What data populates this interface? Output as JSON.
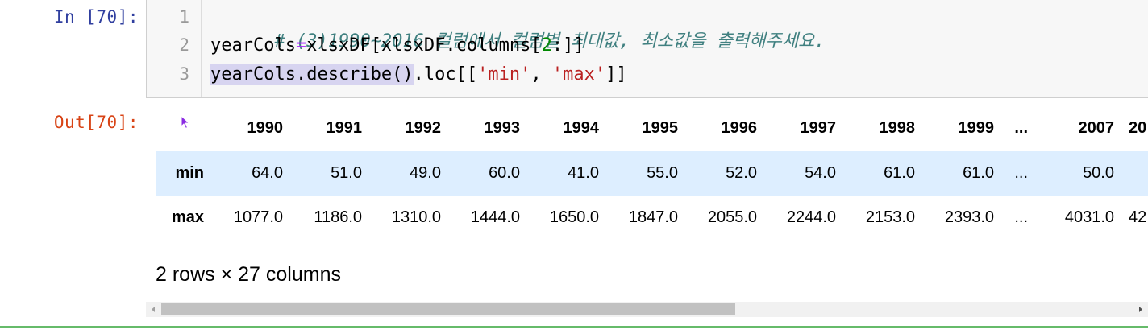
{
  "input_prompt": "In [70]:",
  "output_prompt": "Out[70]:",
  "code": {
    "line_numbers": [
      "1",
      "2",
      "3"
    ],
    "line1": {
      "comment": "# (3)1990~2016 컬럼에서 컬럼별 최대값, 최소값을 출력해주세요."
    },
    "line2": {
      "var": "yearCols",
      "op": "=",
      "expr_start": "xlsxDF[xlsxDF.columns[",
      "num": "2",
      "expr_end": ":]]"
    },
    "line3": {
      "highlighted": "yearCols.describe()",
      "mid": ".loc[[",
      "str1": "'min'",
      "sep": ", ",
      "str2": "'max'",
      "end": "]]"
    }
  },
  "table": {
    "columns": [
      "1990",
      "1991",
      "1992",
      "1993",
      "1994",
      "1995",
      "1996",
      "1997",
      "1998",
      "1999",
      "...",
      "2007",
      "20"
    ],
    "rows": [
      {
        "index": "min",
        "values": [
          "64.0",
          "51.0",
          "49.0",
          "60.0",
          "41.0",
          "55.0",
          "52.0",
          "54.0",
          "61.0",
          "61.0",
          "...",
          "50.0",
          ""
        ]
      },
      {
        "index": "max",
        "values": [
          "1077.0",
          "1186.0",
          "1310.0",
          "1444.0",
          "1650.0",
          "1847.0",
          "2055.0",
          "2244.0",
          "2153.0",
          "2393.0",
          "...",
          "4031.0",
          "42"
        ]
      }
    ]
  },
  "shape_note": "2 rows × 27 columns",
  "scrollbar": {
    "position_fraction": 0.58,
    "left_arrow": "◂",
    "right_arrow": "▸"
  },
  "colors": {
    "in_prompt": "#303f9f",
    "out_prompt": "#d84315",
    "comment": "#408080",
    "string": "#ba2121",
    "number": "#008800",
    "operator": "#aa22ff",
    "row_highlight": "#ddeeff",
    "cell_border": "#66bb6a"
  },
  "icons": [
    "mouse-pointer-icon",
    "scroll-left-arrow-icon",
    "scroll-right-arrow-icon"
  ]
}
